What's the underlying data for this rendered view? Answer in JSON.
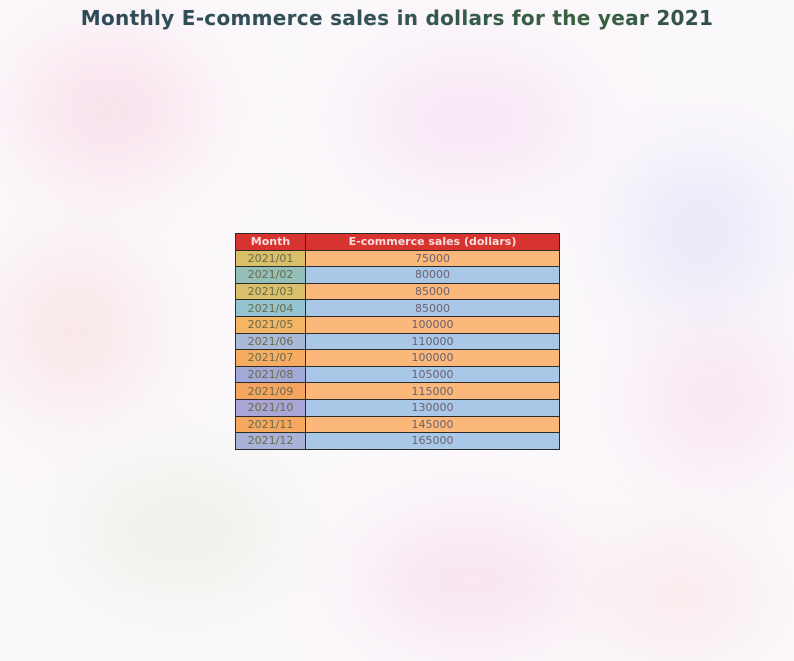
{
  "colors": {
    "header_background": "#d9332f",
    "header_text": "#f4dede",
    "row_odd_background": "#fbb87a",
    "row_even_background": "#a9c8e8",
    "month_cell_tints": [
      "#d9bf6a",
      "#93bfb8",
      "#d9bf6a",
      "#93c4cf",
      "#f4b565",
      "#a9b9d8",
      "#f6ad62",
      "#a2a9d6",
      "#f5a55f",
      "#a9a5d6",
      "#f6a85f",
      "#a9b3d9"
    ]
  },
  "chart_data": {
    "type": "table",
    "title": "Monthly E-commerce sales in dollars for the year 2021",
    "columns": [
      "Month",
      "E-commerce sales (dollars)"
    ],
    "rows": [
      [
        "2021/01",
        "75000"
      ],
      [
        "2021/02",
        "80000"
      ],
      [
        "2021/03",
        "85000"
      ],
      [
        "2021/04",
        "85000"
      ],
      [
        "2021/05",
        "100000"
      ],
      [
        "2021/06",
        "110000"
      ],
      [
        "2021/07",
        "100000"
      ],
      [
        "2021/08",
        "105000"
      ],
      [
        "2021/09",
        "115000"
      ],
      [
        "2021/10",
        "130000"
      ],
      [
        "2021/11",
        "145000"
      ],
      [
        "2021/12",
        "165000"
      ]
    ]
  }
}
